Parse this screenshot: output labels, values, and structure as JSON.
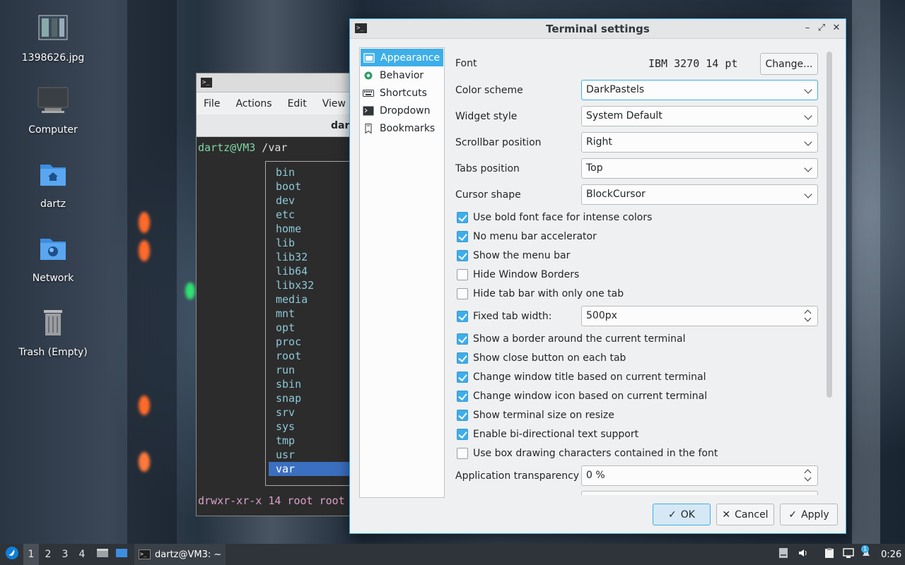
{
  "desktop": {
    "icons": [
      {
        "label": "1398626.jpg",
        "icon": "image-file-icon"
      },
      {
        "label": "Computer",
        "icon": "computer-icon"
      },
      {
        "label": "dartz",
        "icon": "home-folder-icon"
      },
      {
        "label": "Network",
        "icon": "network-folder-icon"
      },
      {
        "label": "Trash (Empty)",
        "icon": "trash-icon"
      }
    ]
  },
  "terminal": {
    "menu": [
      "File",
      "Actions",
      "Edit",
      "View"
    ],
    "tab_title": "dartz",
    "prompt_user": "dartz@VM3",
    "prompt_path": " /var",
    "completions": [
      "bin",
      "boot",
      "dev",
      "etc",
      "home",
      "lib",
      "lib32",
      "lib64",
      "libx32",
      "media",
      "mnt",
      "opt",
      "proc",
      "root",
      "run",
      "sbin",
      "snap",
      "srv",
      "sys",
      "tmp",
      "usr",
      "var"
    ],
    "selected_completion": "var",
    "perm_line": "drwxr-xr-x 14 root root"
  },
  "dialog": {
    "title": "Terminal settings",
    "sidebar": [
      {
        "label": "Appearance",
        "icon": "appearance-icon",
        "active": true
      },
      {
        "label": "Behavior",
        "icon": "behavior-icon",
        "active": false
      },
      {
        "label": "Shortcuts",
        "icon": "keyboard-icon",
        "active": false
      },
      {
        "label": "Dropdown",
        "icon": "dropdown-terminal-icon",
        "active": false
      },
      {
        "label": "Bookmarks",
        "icon": "bookmark-icon",
        "active": false
      }
    ],
    "font": {
      "label": "Font",
      "value": "IBM 3270 14 pt",
      "button": "Change..."
    },
    "color_scheme": {
      "label": "Color scheme",
      "value": "DarkPastels"
    },
    "widget_style": {
      "label": "Widget style",
      "value": "System Default"
    },
    "scrollbar_position": {
      "label": "Scrollbar position",
      "value": "Right"
    },
    "tabs_position": {
      "label": "Tabs position",
      "value": "Top"
    },
    "cursor_shape": {
      "label": "Cursor shape",
      "value": "BlockCursor"
    },
    "checkboxes_a": [
      {
        "label": "Use bold font face for intense colors",
        "checked": true
      },
      {
        "label": "No menu bar accelerator",
        "checked": true
      },
      {
        "label": "Show the menu bar",
        "checked": true
      },
      {
        "label": "Hide Window Borders",
        "checked": false
      },
      {
        "label": "Hide tab bar with only one tab",
        "checked": false
      }
    ],
    "fixed_tab_width": {
      "label": "Fixed tab width:",
      "checked": true,
      "value": "500px"
    },
    "checkboxes_b": [
      {
        "label": "Show a border around the current terminal",
        "checked": true
      },
      {
        "label": "Show close button on each tab",
        "checked": true
      },
      {
        "label": "Change window title based on current terminal",
        "checked": true
      },
      {
        "label": "Change window icon based on current terminal",
        "checked": true
      },
      {
        "label": "Show terminal size on resize",
        "checked": true
      },
      {
        "label": "Enable bi-directional text support",
        "checked": true
      },
      {
        "label": "Use box drawing characters contained in the font",
        "checked": false
      }
    ],
    "app_transparency": {
      "label": "Application transparency",
      "value": "0 %"
    },
    "buttons": {
      "ok": "OK",
      "cancel": "Cancel",
      "apply": "Apply"
    }
  },
  "taskbar": {
    "workspaces": [
      "1",
      "2",
      "3",
      "4"
    ],
    "current_workspace": "1",
    "task_label": "dartz@VM3: ~",
    "clock": "0:26",
    "notification_badge": "1"
  },
  "colors": {
    "accent": "#3daee9",
    "terminal_bg": "#2c2c2c",
    "taskbar_bg": "#2f343a"
  }
}
